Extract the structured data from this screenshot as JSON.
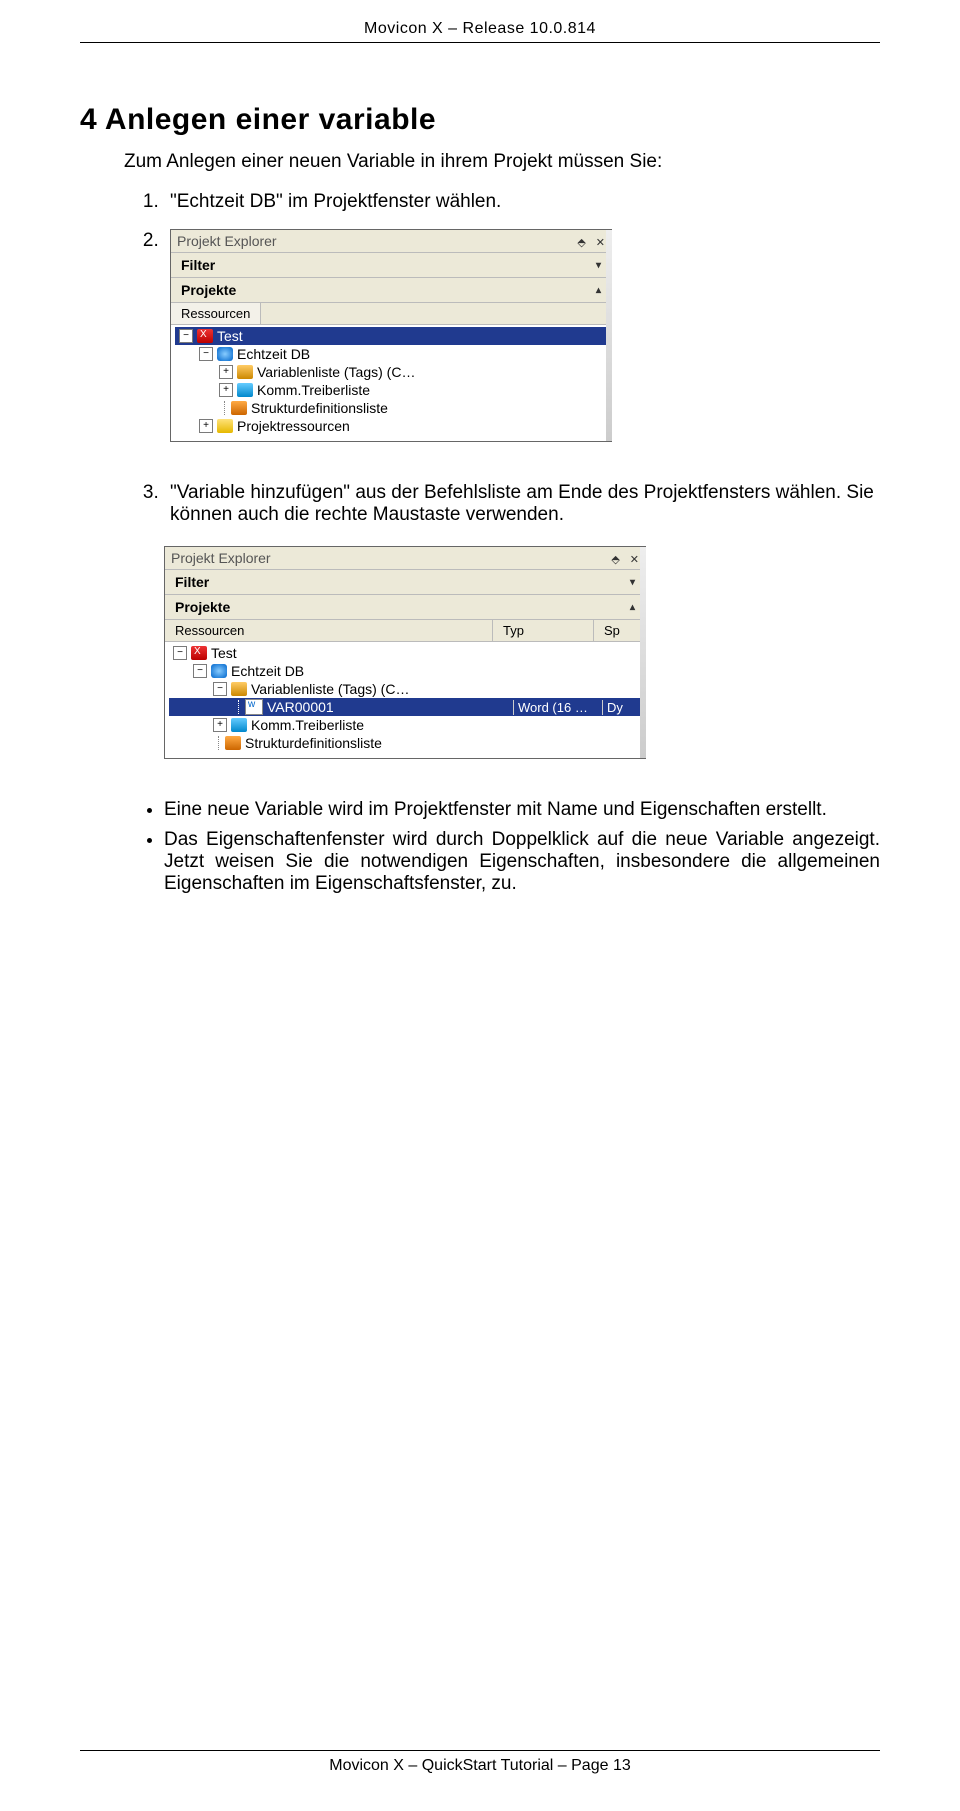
{
  "header": "Movicon X – Release 10.0.814",
  "h1": "4 Anlegen einer variable",
  "intro": "Zum Anlegen einer neuen Variable in ihrem Projekt müssen Sie:",
  "step1": "\"Echtzeit DB\" im Projektfenster wählen.",
  "step2_marker": "2.",
  "step3": "\"Variable hinzufügen\" aus der Befehlsliste am Ende des Projektfensters wählen. Sie können auch die rechte Maustaste verwenden.",
  "shot1": {
    "title": "Projekt Explorer",
    "pin": "⬘",
    "close": "✕",
    "filter": "Filter",
    "filter_arrow": "▾",
    "projekte": "Projekte",
    "projekte_arrow": "▴",
    "tab": "Ressourcen",
    "tree": {
      "test": "Test",
      "db": "Echtzeit DB",
      "tags": "Variablenliste (Tags) (C…",
      "drv": "Komm.Treiberliste",
      "str": "Strukturdefinitionsliste",
      "res": "Projektressourcen"
    }
  },
  "shot2": {
    "title": "Projekt Explorer",
    "pin": "⬘",
    "close": "✕",
    "filter": "Filter",
    "filter_arrow": "▾",
    "projekte": "Projekte",
    "projekte_arrow": "▴",
    "cols": {
      "c1": "Ressourcen",
      "c2": "Typ",
      "c3": "Sp"
    },
    "tree": {
      "test": "Test",
      "db": "Echtzeit DB",
      "tags": "Variablenliste (Tags) (C…",
      "var": "VAR00001",
      "var_typ": "Word (16 …",
      "var_sp": "Dy",
      "drv": "Komm.Treiberliste",
      "str": "Strukturdefinitionsliste"
    }
  },
  "bul1": "Eine neue Variable wird im Projektfenster mit Name und Eigenschaften erstellt.",
  "bul2": "Das Eigenschaftenfenster wird durch Doppelklick auf die neue Variable angezeigt. Jetzt weisen Sie die notwendigen Eigenschaften, insbesondere die allgemeinen Eigenschaften im Eigenschaftsfenster, zu.",
  "footer": "Movicon X – QuickStart Tutorial – Page 13"
}
